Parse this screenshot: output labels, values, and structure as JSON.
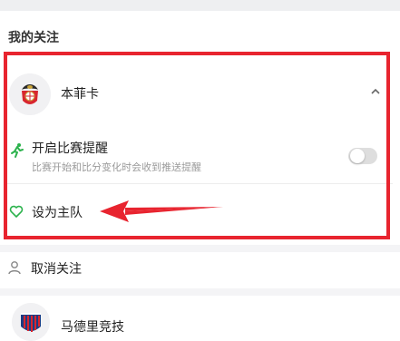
{
  "section": {
    "title": "我的关注"
  },
  "followed_team": {
    "name": "本菲卡",
    "logo_icon": "benfica-crest-icon",
    "expand_icon": "chevron-up-icon"
  },
  "match_reminder": {
    "title": "开启比赛提醒",
    "description": "比赛开始和比分变化时会收到推送提醒",
    "enabled": false,
    "icon": "runner-icon"
  },
  "home_team_action": {
    "label": "设为主队",
    "icon": "heart-outline-icon"
  },
  "unfollow_action": {
    "label": "取消关注",
    "icon": "user-icon"
  },
  "next_team": {
    "name": "马德里竞技",
    "logo_icon": "atletico-madrid-crest-icon"
  },
  "colors": {
    "accent_green": "#2bb24c",
    "highlight_red": "#e8242f",
    "muted_text": "#9a9a9a"
  }
}
